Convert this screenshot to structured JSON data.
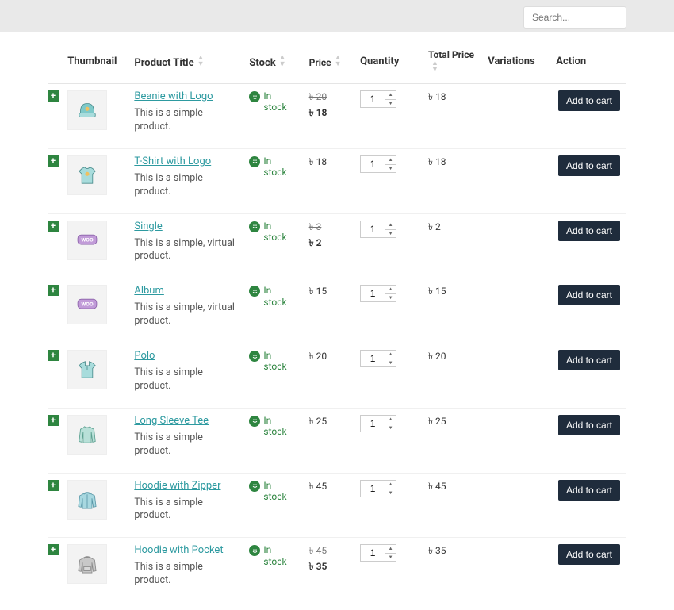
{
  "search": {
    "placeholder": "Search..."
  },
  "headers": {
    "thumbnail": "Thumbnail",
    "title": "Product Title",
    "stock": "Stock",
    "price": "Price",
    "quantity": "Quantity",
    "total": "Total Price",
    "variations": "Variations",
    "action": "Action"
  },
  "stock_label": "In stock",
  "add_to_cart": "Add to cart",
  "currency": "৳",
  "rows": [
    {
      "name": "Beanie with Logo",
      "desc": "This is a simple product.",
      "old_price": "20",
      "price": "18",
      "qty": "1",
      "total": "18",
      "icon": "beanie"
    },
    {
      "name": "T-Shirt with Logo",
      "desc": "This is a simple product.",
      "old_price": null,
      "price": "18",
      "qty": "1",
      "total": "18",
      "icon": "tshirt"
    },
    {
      "name": "Single",
      "desc": "This is a simple, virtual product.",
      "old_price": "3",
      "price": "2",
      "qty": "1",
      "total": "2",
      "icon": "woo"
    },
    {
      "name": "Album",
      "desc": "This is a simple, virtual product.",
      "old_price": null,
      "price": "15",
      "qty": "1",
      "total": "15",
      "icon": "woo"
    },
    {
      "name": "Polo",
      "desc": "This is a simple product.",
      "old_price": null,
      "price": "20",
      "qty": "1",
      "total": "20",
      "icon": "polo"
    },
    {
      "name": "Long Sleeve Tee",
      "desc": "This is a simple product.",
      "old_price": null,
      "price": "25",
      "qty": "1",
      "total": "25",
      "icon": "longsleeve"
    },
    {
      "name": "Hoodie with Zipper",
      "desc": "This is a simple product.",
      "old_price": null,
      "price": "45",
      "qty": "1",
      "total": "45",
      "icon": "hoodie-zip"
    },
    {
      "name": "Hoodie with Pocket",
      "desc": "This is a simple product.",
      "old_price": "45",
      "price": "35",
      "qty": "1",
      "total": "35",
      "icon": "hoodie-pocket"
    }
  ]
}
